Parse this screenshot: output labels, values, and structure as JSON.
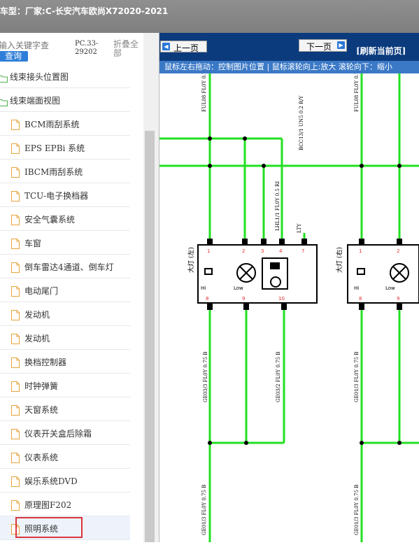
{
  "header": {
    "vehicle_label": "车型：",
    "vehicle": "厂家:C-长安汽车欧尚X72020-2021"
  },
  "search": {
    "placeholder": "输入关键字查",
    "button": "查询"
  },
  "code": {
    "line1": "PC.33-",
    "line2": "29202"
  },
  "collapse_all": "折叠全部",
  "tree": [
    {
      "label": "线束接头位置图",
      "type": "folder"
    },
    {
      "label": "线束端面视图",
      "type": "folder"
    },
    {
      "label": "BCM雨刮系统",
      "type": "doc"
    },
    {
      "label": "EPS EPBi 系统",
      "type": "doc"
    },
    {
      "label": "IBCM雨刮系统",
      "type": "doc"
    },
    {
      "label": "TCU-电子换档器",
      "type": "doc"
    },
    {
      "label": "安全气囊系统",
      "type": "doc"
    },
    {
      "label": "车窗",
      "type": "doc"
    },
    {
      "label": "倒车雷达4通道、倒车灯",
      "type": "doc"
    },
    {
      "label": "电动尾门",
      "type": "doc"
    },
    {
      "label": "发动机",
      "type": "doc"
    },
    {
      "label": "发动机",
      "type": "doc"
    },
    {
      "label": "换档控制器",
      "type": "doc"
    },
    {
      "label": "时钟弹簧",
      "type": "doc"
    },
    {
      "label": "天窗系统",
      "type": "doc"
    },
    {
      "label": "仪表开关盒后除霜",
      "type": "doc"
    },
    {
      "label": "仪表系统",
      "type": "doc"
    },
    {
      "label": "娱乐系统DVD",
      "type": "doc"
    },
    {
      "label": "原理图F202",
      "type": "doc"
    },
    {
      "label": "照明系统",
      "type": "doc",
      "selected": true
    }
  ],
  "toolbar": {
    "prev": "上一页",
    "next": "下一页",
    "refresh": "[刷新当前页]",
    "hint": "鼠标左右拖动：控制图片位置 | 鼠标滚轮向上:放大  滚轮向下：缩小"
  },
  "diagram": {
    "wire_labels": [
      "FUL08 FL0Y 0.7",
      "BCC13/1 UN5 0.2 R/Y",
      "LHL1/1 FL0Y 0.5 RI",
      "LTY",
      "FUL08 FL0Y 0.7",
      "GE03/3 FL0Y 0.75 B",
      "GE03/2 FL0Y 0.75 B",
      "GE01/3 FL0Y 0.75 B",
      "GE01/3 FL0Y 0.75 B",
      "GE01/3 FL0Y 0.75 B"
    ],
    "component_left": "大灯 (左)",
    "component_right": "大灯 (右)",
    "pin_hi": "Hi",
    "pin_low": "Low",
    "pins": [
      "1",
      "2",
      "3",
      "4",
      "7",
      "8",
      "9",
      "10"
    ],
    "colors": {
      "wire": "#22e022",
      "outline": "#000000"
    }
  }
}
